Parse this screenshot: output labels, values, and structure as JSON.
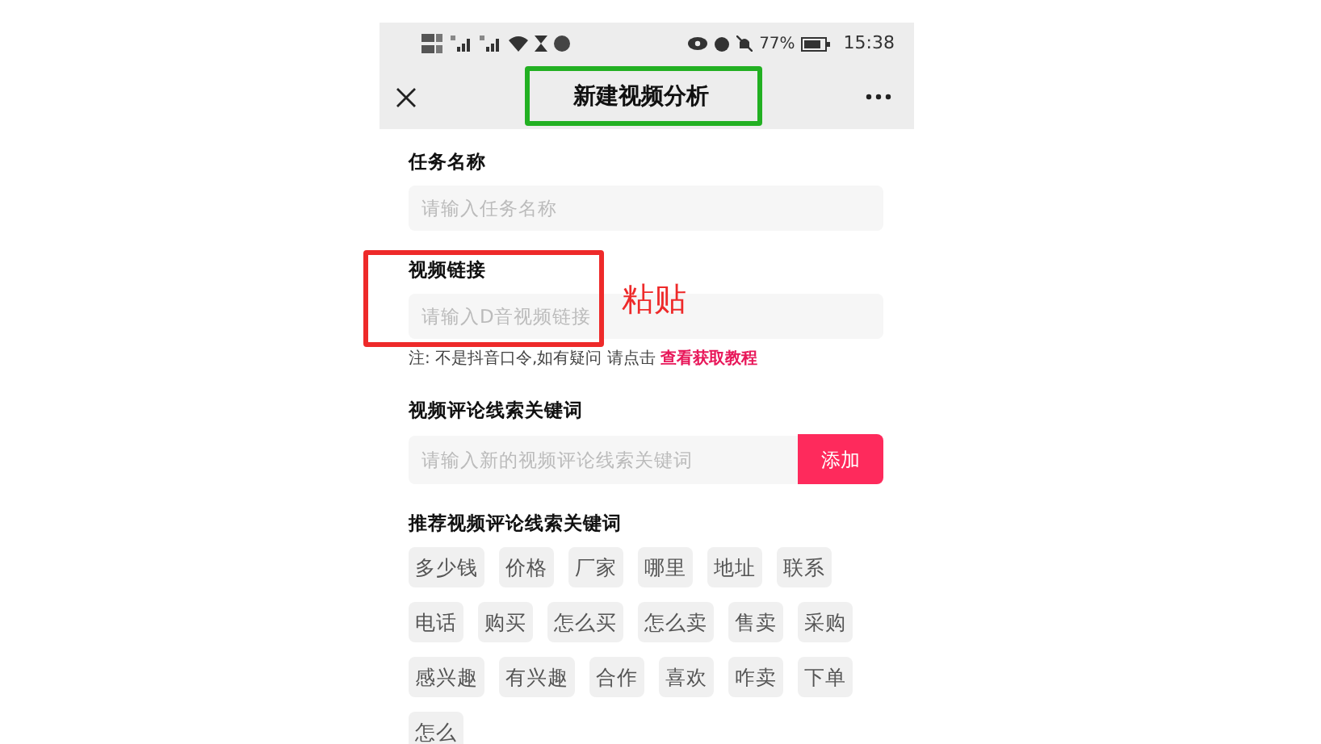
{
  "status_bar": {
    "battery": "77%",
    "time": "15:38"
  },
  "header": {
    "title": "新建视频分析"
  },
  "form": {
    "fields": [
      {
        "label": "任务名称",
        "placeholder": "请输入任务名称"
      },
      {
        "label": "视频链接",
        "placeholder": "请输入D音视频链接"
      }
    ],
    "note": {
      "text": "注: 不是抖音口令,如有疑问 请点击",
      "link": "查看获取教程"
    },
    "keyword": {
      "label": "视频评论线索关键词",
      "placeholder": "请输入新的视频评论线索关键词",
      "button": "添加"
    },
    "recommended": {
      "label": "推荐视频评论线索关键词",
      "tags": [
        "多少钱",
        "价格",
        "厂家",
        "哪里",
        "地址",
        "联系",
        "电话",
        "购买",
        "怎么买",
        "怎么卖",
        "售卖",
        "采购",
        "感兴趣",
        "有兴趣",
        "合作",
        "喜欢",
        "咋卖",
        "下单",
        "怎么"
      ]
    }
  },
  "annotations": [
    {
      "kind": "title-box",
      "color": "#22b022"
    },
    {
      "kind": "field-box",
      "color": "#ee2a2a"
    },
    {
      "kind": "note",
      "text": "粘贴",
      "color": "#ee2a2a"
    }
  ]
}
